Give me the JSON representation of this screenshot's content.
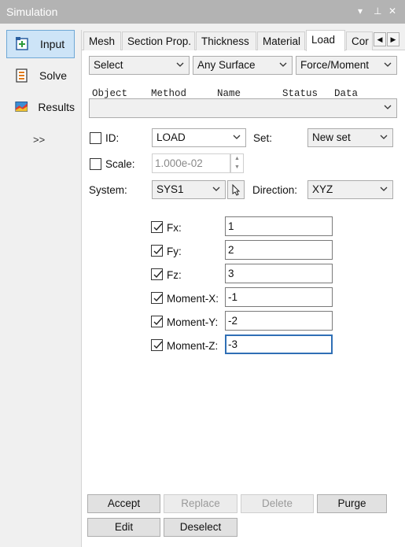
{
  "window": {
    "title": "Simulation",
    "menu_glyph": "▾",
    "pin_glyph": "⊥",
    "close_glyph": "✕"
  },
  "sidebar": {
    "items": [
      {
        "label": "Input",
        "icon": "add-input-icon",
        "active": true
      },
      {
        "label": "Solve",
        "icon": "solve-list-icon",
        "active": false
      },
      {
        "label": "Results",
        "icon": "results-chart-icon",
        "active": false
      }
    ],
    "more": ">>"
  },
  "tabs": [
    "Mesh",
    "Section Prop.",
    "Thickness",
    "Material",
    "Load",
    "Cor"
  ],
  "active_tab": "Load",
  "filters": {
    "select": "Select",
    "surface": "Any Surface",
    "type": "Force/Moment"
  },
  "columns": [
    "Object",
    "Method",
    "Name",
    "Status",
    "Data"
  ],
  "id_row": {
    "label": "ID:",
    "value": "LOAD",
    "set_label": "Set:",
    "set_value": "New set"
  },
  "scale_row": {
    "label": "Scale:",
    "value": "1.000e-02"
  },
  "system_row": {
    "label": "System:",
    "value": "SYS1",
    "direction_label": "Direction:",
    "direction_value": "XYZ"
  },
  "components": [
    {
      "label": "Fx:",
      "value": "1",
      "checked": true
    },
    {
      "label": "Fy:",
      "value": "2",
      "checked": true
    },
    {
      "label": "Fz:",
      "value": "3",
      "checked": true
    },
    {
      "label": "Moment-X:",
      "value": "-1",
      "checked": true
    },
    {
      "label": "Moment-Y:",
      "value": "-2",
      "checked": true
    },
    {
      "label": "Moment-Z:",
      "value": "-3",
      "checked": true
    }
  ],
  "buttons": {
    "accept": "Accept",
    "replace": "Replace",
    "delete": "Delete",
    "purge": "Purge",
    "edit": "Edit",
    "deselect": "Deselect"
  }
}
